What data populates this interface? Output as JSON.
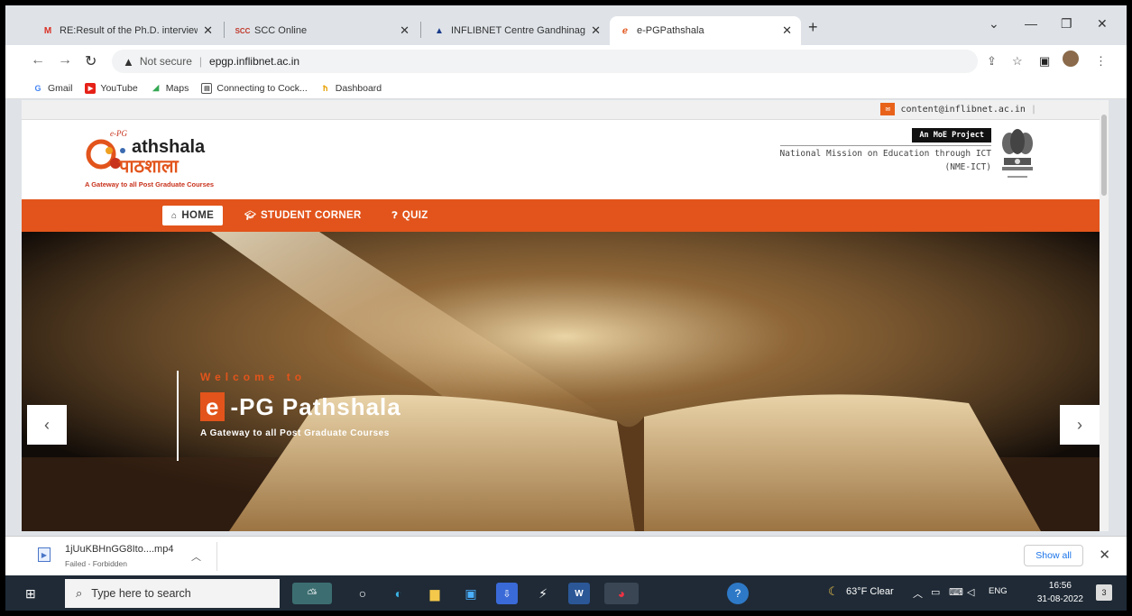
{
  "browser": {
    "tabs": [
      {
        "title": "RE:Result of the Ph.D. interview -",
        "favicon": "gmail-icon"
      },
      {
        "title": "SCC Online",
        "favicon": "scc-icon"
      },
      {
        "title": "INFLIBNET Centre Gandhinagar",
        "favicon": "inflibnet-icon"
      },
      {
        "title": "e-PGPathshala",
        "favicon": "epg-icon",
        "active": true
      }
    ],
    "omnibox": {
      "security": "Not secure",
      "url": "epgp.inflibnet.ac.in"
    },
    "bookmarks": [
      {
        "label": "Gmail",
        "icon": "google-icon"
      },
      {
        "label": "YouTube",
        "icon": "youtube-icon"
      },
      {
        "label": "Maps",
        "icon": "maps-icon"
      },
      {
        "label": "Connecting to Cock...",
        "icon": "page-icon"
      },
      {
        "label": "Dashboard",
        "icon": "dashboard-icon"
      }
    ]
  },
  "site": {
    "contact_email": "content@inflibnet.ac.in",
    "logo": {
      "top": "athshala",
      "hindi": "पाठशाला",
      "tagline": "A Gateway to all Post Graduate Courses"
    },
    "moe": {
      "badge": "An MoE Project",
      "line1": "National Mission on Education through ICT",
      "line2": "(NME-ICT)"
    },
    "nav": [
      {
        "label": "HOME",
        "icon": "home-icon",
        "active": true
      },
      {
        "label": "STUDENT CORNER",
        "icon": "graduation-cap-icon"
      },
      {
        "label": "QUIZ",
        "icon": "question-icon"
      }
    ],
    "hero": {
      "welcome": "Welcome to",
      "title_e": "e",
      "title_rest": "-PG Pathshala",
      "subtitle": "A Gateway to all Post Graduate Courses"
    }
  },
  "download": {
    "filename": "1jUuKBHnGG8Ito....mp4",
    "status": "Failed - Forbidden",
    "show_all": "Show all"
  },
  "taskbar": {
    "search_placeholder": "Type here to search",
    "weather": "63°F Clear",
    "lang": "ENG",
    "time": "16:56",
    "date": "31-08-2022",
    "notifications": "3"
  },
  "colors": {
    "brand_orange": "#e2541b",
    "taskbar": "#1f2a36"
  }
}
